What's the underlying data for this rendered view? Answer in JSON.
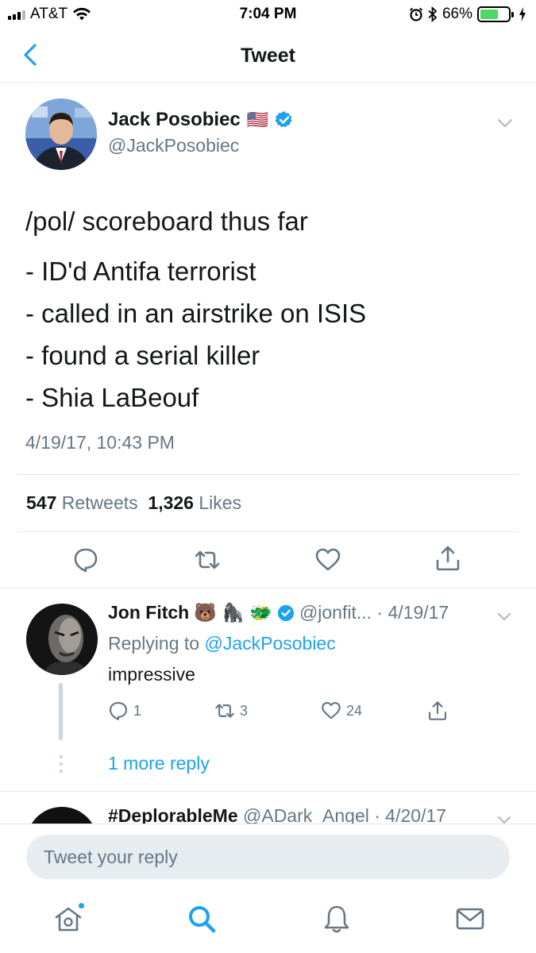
{
  "status_bar": {
    "carrier": "AT&T",
    "time": "7:04 PM",
    "battery_percent": "66%",
    "battery_level": 0.66,
    "icons": [
      "signal-icon",
      "wifi-icon",
      "alarm-icon",
      "bluetooth-icon",
      "battery-icon",
      "charging-icon"
    ]
  },
  "nav": {
    "title": "Tweet",
    "back_icon": "chevron-left-icon"
  },
  "tweet": {
    "author_name": "Jack Posobiec",
    "flag": "🇺🇸",
    "handle": "@JackPosobiec",
    "text_line1": "/pol/ scoreboard thus far",
    "text_items": [
      "- ID'd Antifa terrorist",
      "- called in an airstrike on ISIS",
      "- found a serial killer",
      "- Shia LaBeouf"
    ],
    "timestamp": "4/19/17, 10:43 PM",
    "retweet_count": "547",
    "retweets_label": "Retweets",
    "like_count": "1,326",
    "likes_label": "Likes"
  },
  "reply": {
    "name": "Jon Fitch",
    "emojis": "🐻 🦍 🐲",
    "handle_time": "@jonfit... · 4/19/17",
    "replying_prefix": "Replying to",
    "replying_to": "@JackPosobiec",
    "text": "impressive",
    "reply_count": "1",
    "retweet_count": "3",
    "like_count": "24",
    "more_replies": "1 more reply"
  },
  "reply2": {
    "name": "#DeplorableMe",
    "handle_time": "@ADark_Angel · 4/20/17"
  },
  "compose": {
    "placeholder": "Tweet your reply"
  },
  "tabs": [
    "home-icon",
    "search-icon",
    "notifications-icon",
    "messages-icon"
  ],
  "colors": {
    "accent": "#1da1f2",
    "text": "#14171a",
    "secondary": "#657786",
    "divider": "#e1e8ed"
  }
}
